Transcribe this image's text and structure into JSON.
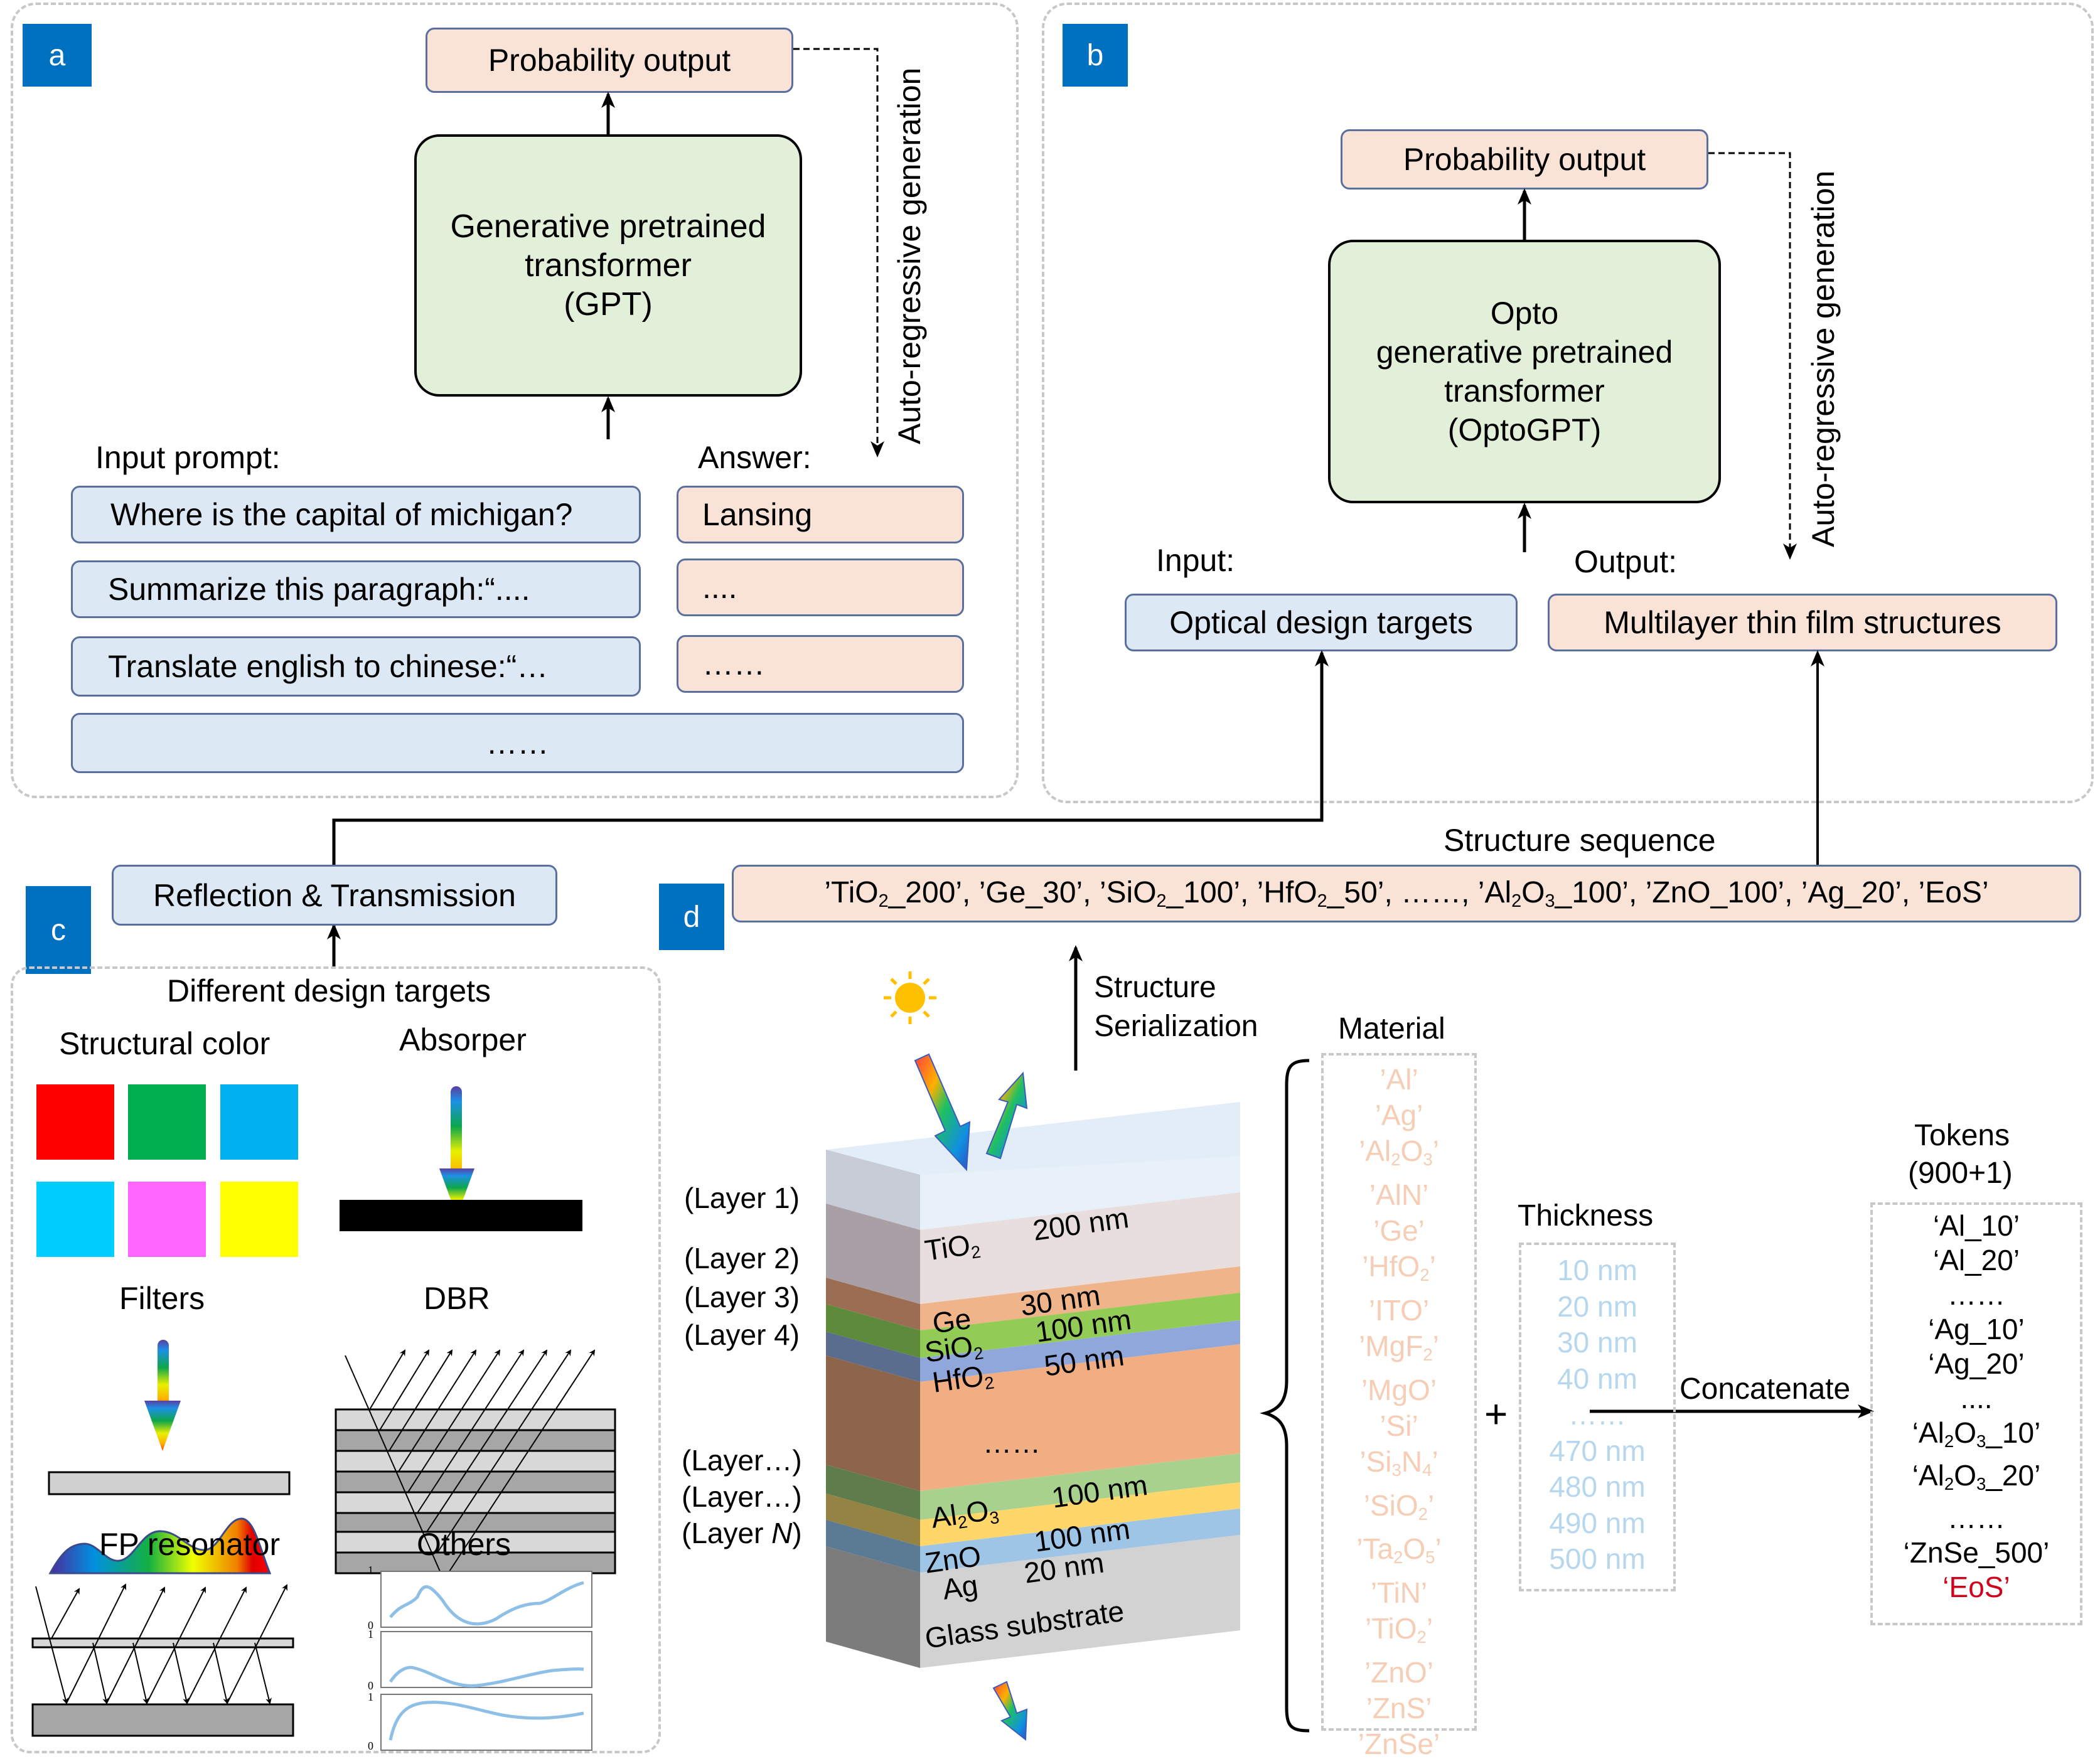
{
  "panel_a": {
    "tag": "a",
    "probability_output": "Probability output",
    "model_line1": "Generative pretrained",
    "model_line2": "transformer",
    "model_line3": "(GPT)",
    "loop_label": "Auto-regressive generation",
    "input_label": "Input prompt:",
    "answer_label": "Answer:",
    "prompts": [
      "Where is the capital of michigan?",
      "Summarize this paragraph:“....",
      "Translate english to chinese:“…"
    ],
    "answers": [
      "Lansing",
      "....",
      "……"
    ],
    "more": "……"
  },
  "panel_b": {
    "tag": "b",
    "probability_output": "Probability output",
    "model_line1": "Opto",
    "model_line2": "generative pretrained",
    "model_line3": "transformer",
    "model_line4": "(OptoGPT)",
    "loop_label": "Auto-regressive generation",
    "input_label": "Input:",
    "output_label": "Output:",
    "input_box": "Optical design targets",
    "output_box": "Multilayer thin film structures"
  },
  "panel_c": {
    "tag": "c",
    "rt_box": "Reflection & Transmission",
    "title": "Different design targets",
    "structural_color": "Structural color",
    "absorber": "Absorper",
    "filters": "Filters",
    "dbr": "DBR",
    "fp": "FP resonator",
    "others": "Others",
    "swatch_colors": [
      "#ff0000",
      "#00ad4f",
      "#00b0ef",
      "#00cdfe",
      "#ff66ff",
      "#ffff00"
    ],
    "plot_ticks": [
      "1",
      "0"
    ]
  },
  "panel_d": {
    "tag": "d",
    "sequence_label": "Structure sequence",
    "sequence": [
      {
        "m": "TiO",
        "sub": "2",
        "t": "200"
      },
      {
        "m": "Ge",
        "sub": "",
        "t": "30"
      },
      {
        "m": "SiO",
        "sub": "2",
        "t": "100"
      },
      {
        "m": "HfO",
        "sub": "2",
        "t": "50"
      },
      {
        "m": "……",
        "sub": "",
        "t": ""
      },
      {
        "m": "Al",
        "sub": "2",
        "m2": "O",
        "sub2": "3",
        "t": "100"
      },
      {
        "m": "ZnO",
        "sub": "",
        "t": "100"
      },
      {
        "m": "Ag",
        "sub": "",
        "t": "20"
      },
      {
        "m": "EoS",
        "sub": "",
        "t": ""
      }
    ],
    "serialization_line1": "Structure",
    "serialization_line2": "Serialization",
    "layer_labels": [
      "(Layer 1)",
      "(Layer 2)",
      "(Layer 3)",
      "(Layer 4)",
      "(Layer…)",
      "(Layer…)",
      "(Layer N)"
    ],
    "stack": [
      {
        "name": "TiO",
        "sub": "2",
        "thickness": "200 nm"
      },
      {
        "name": "Ge",
        "sub": "",
        "thickness": "30 nm"
      },
      {
        "name": "SiO",
        "sub": "2",
        "thickness": "100 nm"
      },
      {
        "name": "HfO",
        "sub": "2",
        "thickness": "50 nm"
      },
      {
        "name": "……",
        "sub": "",
        "thickness": ""
      },
      {
        "name": "Al",
        "sub": "2",
        "name2": "O",
        "sub2": "3",
        "thickness": "100 nm"
      },
      {
        "name": "ZnO",
        "sub": "",
        "thickness": "100 nm"
      },
      {
        "name": "Ag",
        "sub": "",
        "thickness": "20 nm"
      }
    ],
    "substrate": "Glass substrate",
    "material_title": "Material",
    "materials": [
      "'Al'",
      "'Ag'",
      "'Al2O3'",
      "'AlN'",
      "'Ge'",
      "'HfO2'",
      "'ITO'",
      "'MgF2'",
      "'MgO'",
      "'Si'",
      "'Si3N4'",
      "'SiO2'",
      "'Ta2O5'",
      "'TiN'",
      "'TiO2'",
      "'ZnO'",
      "'ZnS'",
      "'ZnSe'"
    ],
    "plus": "+",
    "thickness_title": "Thickness",
    "thicknesses": [
      "10 nm",
      "20 nm",
      "30 nm",
      "40 nm",
      "……",
      "470 nm",
      "480 nm",
      "490 nm",
      "500 nm"
    ],
    "concatenate": "Concatenate",
    "tokens_title_line1": "Tokens",
    "tokens_title_line2": "(900+1)",
    "tokens": [
      "‘Al_10’",
      "‘Al_20’",
      "……",
      "‘Ag_10’",
      "‘Ag_20’",
      "....",
      "‘Al2O3_10’",
      "‘Al2O3_20’",
      "……",
      "‘ZnSe_500’"
    ],
    "eos_token": "‘EoS’",
    "eos_color": "#d0021b"
  },
  "colors": {
    "tag_blue": "#0070c0",
    "input_blue": "#dde8f5",
    "output_peach": "#f9e3d7",
    "model_green": "#e2efd9"
  }
}
